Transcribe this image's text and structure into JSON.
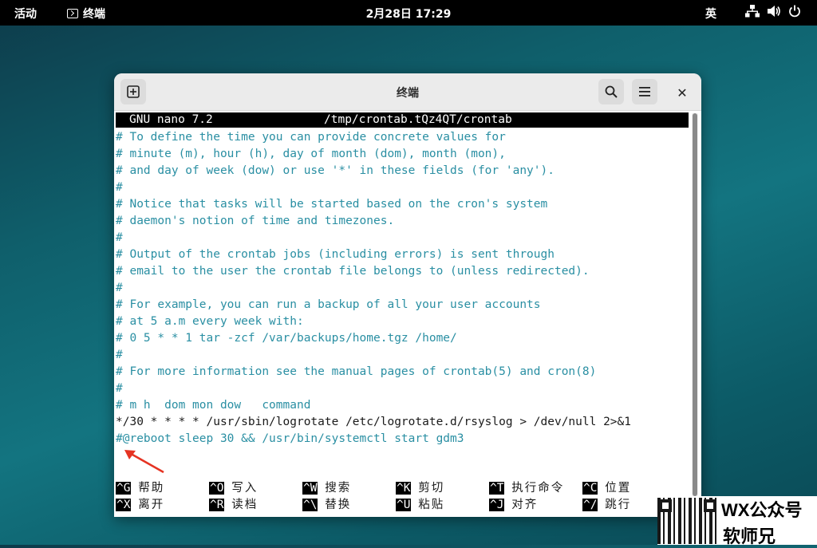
{
  "topbar": {
    "activities": "活动",
    "app_name": "终端",
    "clock": "2月28日 17:29",
    "input_method": "英",
    "icons": [
      "network-icon",
      "volume-icon",
      "power-icon"
    ]
  },
  "window": {
    "title": "终端",
    "buttons": [
      "new-tab-icon",
      "search-icon",
      "menu-icon",
      "close-icon"
    ],
    "close_glyph": "✕"
  },
  "nano": {
    "header": {
      "version": "GNU nano 7.2",
      "filename": "/tmp/crontab.tQz4QT/crontab"
    },
    "lines": [
      {
        "text": "# To define the time you can provide concrete values for",
        "type": "comment"
      },
      {
        "text": "# minute (m), hour (h), day of month (dom), month (mon),",
        "type": "comment"
      },
      {
        "text": "# and day of week (dow) or use '*' in these fields (for 'any').",
        "type": "comment"
      },
      {
        "text": "#",
        "type": "comment"
      },
      {
        "text": "# Notice that tasks will be started based on the cron's system",
        "type": "comment"
      },
      {
        "text": "# daemon's notion of time and timezones.",
        "type": "comment"
      },
      {
        "text": "#",
        "type": "comment"
      },
      {
        "text": "# Output of the crontab jobs (including errors) is sent through",
        "type": "comment"
      },
      {
        "text": "# email to the user the crontab file belongs to (unless redirected).",
        "type": "comment"
      },
      {
        "text": "#",
        "type": "comment"
      },
      {
        "text": "# For example, you can run a backup of all your user accounts",
        "type": "comment"
      },
      {
        "text": "# at 5 a.m every week with:",
        "type": "comment"
      },
      {
        "text": "# 0 5 * * 1 tar -zcf /var/backups/home.tgz /home/",
        "type": "comment"
      },
      {
        "text": "#",
        "type": "comment"
      },
      {
        "text": "# For more information see the manual pages of crontab(5) and cron(8)",
        "type": "comment"
      },
      {
        "text": "#",
        "type": "comment"
      },
      {
        "text": "# m h  dom mon dow   command",
        "type": "comment"
      },
      {
        "text": "*/30 * * * * /usr/sbin/logrotate /etc/logrotate.d/rsyslog > /dev/null 2>&1",
        "type": "normal"
      },
      {
        "text": "#@reboot sleep 30 && /usr/bin/systemctl start gdm3",
        "type": "comment"
      }
    ],
    "shortcuts_row1": [
      {
        "key": "^G",
        "label": "帮助"
      },
      {
        "key": "^O",
        "label": "写入"
      },
      {
        "key": "^W",
        "label": "搜索"
      },
      {
        "key": "^K",
        "label": "剪切"
      },
      {
        "key": "^T",
        "label": "执行命令"
      },
      {
        "key": "^C",
        "label": "位置"
      }
    ],
    "shortcuts_row2": [
      {
        "key": "^X",
        "label": "离开"
      },
      {
        "key": "^R",
        "label": "读档"
      },
      {
        "key": "^\\",
        "label": "替换"
      },
      {
        "key": "^U",
        "label": "粘贴"
      },
      {
        "key": "^J",
        "label": "对齐"
      },
      {
        "key": "^/",
        "label": "跳行"
      }
    ]
  },
  "annotation": {
    "color": "#e53322"
  },
  "watermark": {
    "line1": "WX公众号",
    "line2": "软师兄"
  },
  "colors": {
    "comment": "#2a8fa3",
    "text": "#1a1a1a",
    "nano_bar": "#000000"
  }
}
